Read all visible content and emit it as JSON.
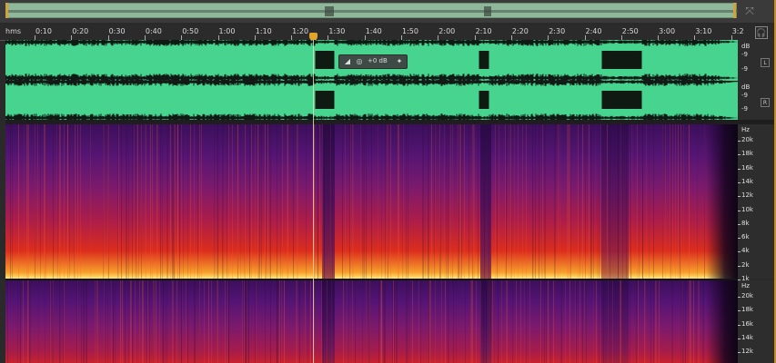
{
  "timeline": {
    "unit_label": "hms",
    "labels": [
      "0:10",
      "0:20",
      "0:30",
      "0:40",
      "0:50",
      "1:00",
      "1:10",
      "1:20",
      "1:30",
      "1:40",
      "1:50",
      "2:00",
      "2:10",
      "2:20",
      "2:30",
      "2:40",
      "2:50",
      "3:00",
      "3:10",
      "3:2"
    ]
  },
  "waveform": {
    "scale_unit": "dB",
    "channel_top": {
      "label": "L",
      "marks": [
        "dB",
        "-9",
        "-9"
      ]
    },
    "channel_bottom": {
      "label": "R",
      "marks": [
        "dB",
        "-9",
        "-9"
      ]
    },
    "hud_gain": "+0 dB"
  },
  "spectral": {
    "unit": "Hz",
    "labels_top": [
      "20k",
      "18k",
      "16k",
      "14k",
      "12k",
      "10k",
      "8k",
      "6k",
      "4k",
      "2k",
      "1k"
    ],
    "labels_bottom": [
      "20k",
      "18k",
      "16k",
      "14k",
      "12k"
    ]
  },
  "colors": {
    "waveform": "#46d48f",
    "playhead": "#e0a52a"
  }
}
